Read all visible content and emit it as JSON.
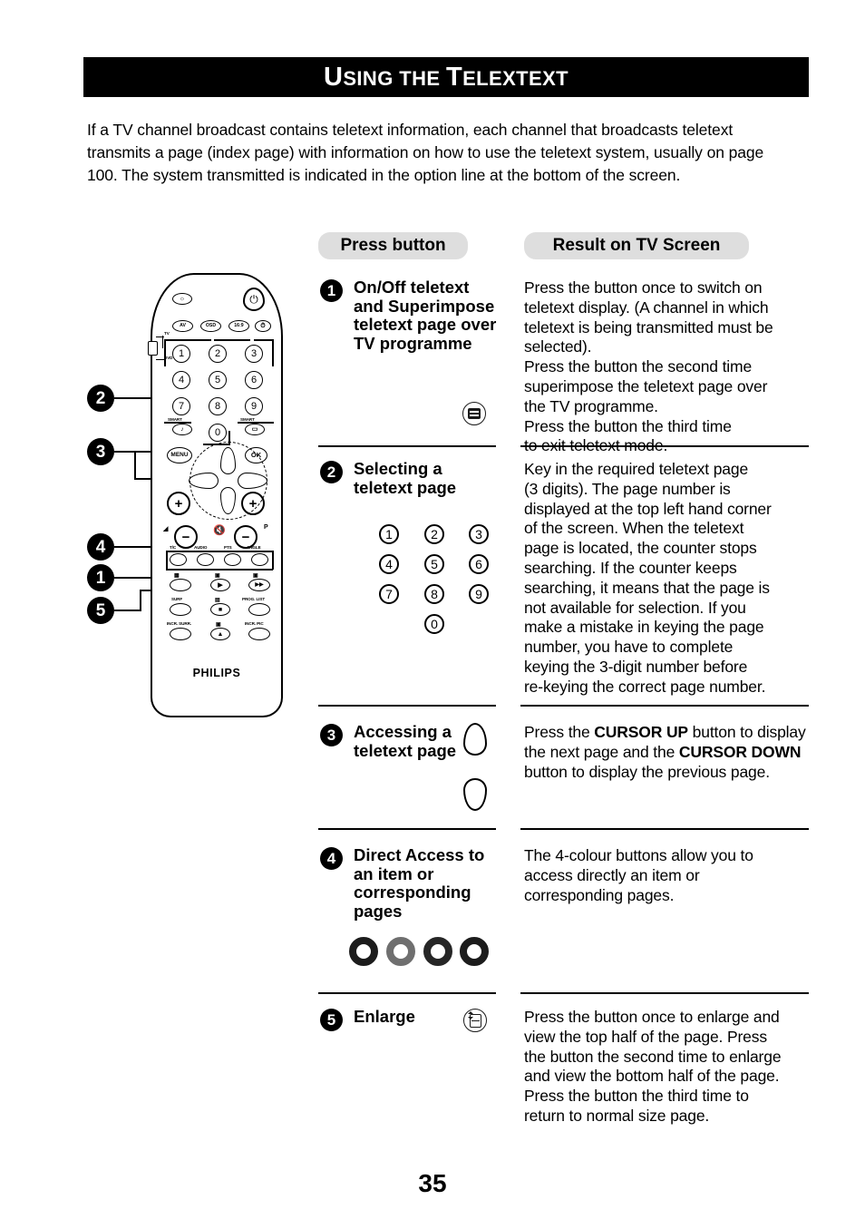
{
  "page": {
    "number": "35",
    "header_title_first_cap": "U",
    "header_title_first_rest": "SING THE ",
    "header_title_second_cap": "T",
    "header_title_second_rest": "ELEXTEXT",
    "intro": "If a TV channel broadcast contains teletext information, each channel that broadcasts teletext transmits a page (index page) with information on how to use the teletext system, usually on page 100. The system transmitted is indicated in the option line at the bottom of the screen."
  },
  "table": {
    "headers": {
      "press_button": "Press button",
      "result": "Result on TV Screen"
    },
    "rows": [
      {
        "number": "1",
        "title": "On/Off teletext and Superimpose teletext page over TV programme",
        "icon": "teletext-icon",
        "result_lines": [
          "Press the button once to switch on",
          "teletext display.  (A channel in which",
          "teletext is being transmitted must be",
          "selected).",
          "Press the button the second time",
          "superimpose the teletext page over",
          "the TV programme.",
          "Press the button the third time",
          "to exit teletext mode."
        ]
      },
      {
        "number": "2",
        "title": "Selecting a teletext page",
        "icon": "numeric-keypad-icon",
        "keypad": [
          "1",
          "2",
          "3",
          "4",
          "5",
          "6",
          "7",
          "8",
          "9",
          "0"
        ],
        "result_lines": [
          "Key in the required teletext page",
          "(3 digits). The page number is",
          "displayed at the top left hand corner",
          "of the screen.  When the teletext",
          "page is located, the counter stops",
          "searching. If the counter keeps",
          "searching, it means that the page is",
          "not available for selection. If you",
          "make a mistake in keying the page",
          "number, you have to complete",
          "keying the 3-digit number before",
          "re-keying the correct page number."
        ]
      },
      {
        "number": "3",
        "title": "Accessing a teletext page",
        "icon": "cursor-up-down-icon",
        "result_html": "Press the <b>CURSOR UP</b> button to display the next page and the <b>CURSOR DOWN</b> button to display the previous page.",
        "result_bold_terms": [
          "CURSOR UP",
          "CURSOR DOWN"
        ]
      },
      {
        "number": "4",
        "title": "Direct Access to an item or corresponding pages",
        "icon": "colour-buttons-icon",
        "colour_buttons": [
          "#1c1c1c",
          "#6f6f6f",
          "#262626",
          "#1c1c1c"
        ],
        "result_lines": [
          "The 4-colour buttons allow you to",
          "access directly an item or",
          "corresponding pages."
        ]
      },
      {
        "number": "5",
        "title": "Enlarge",
        "icon": "enlarge-icon",
        "result_lines": [
          "Press the button once to enlarge and",
          "view the top half of the page.   Press",
          "the button the second time to enlarge",
          "and view the bottom half of the page.",
          "Press the button the third time to",
          "return to  normal size page."
        ]
      }
    ]
  },
  "callouts": [
    {
      "label": "2"
    },
    {
      "label": "3"
    },
    {
      "label": "4"
    },
    {
      "label": "1"
    },
    {
      "label": "5"
    }
  ],
  "remote": {
    "brand": "PHILIPS",
    "switch_labels": {
      "top": "TV",
      "bottom": "DVD"
    },
    "top_row": {
      "left": "sound-icon",
      "power": "power-icon"
    },
    "function_row": [
      "AV",
      "OSD",
      "16:9",
      "timer-icon"
    ],
    "keypad": [
      "1",
      "2",
      "3",
      "4",
      "5",
      "6",
      "7",
      "8",
      "9",
      "0"
    ],
    "smart_labels": {
      "left": "SMART",
      "right": "SMART"
    },
    "nav": {
      "menu": "MENU",
      "ok": "OK"
    },
    "vol_prog": {
      "vol_up": "+",
      "vol_down": "−",
      "prog_up": "+",
      "prog_down": "−",
      "vol_mark": "◢",
      "prog_mark": "P",
      "mute": "mute-icon"
    },
    "colour_row_labels": [
      "T/C",
      "AUDIO",
      "PTS",
      "ANGLE"
    ],
    "media_row_labels": [
      "teletext-icon",
      "subtitle-icon",
      "zoom-icon"
    ],
    "media_row2_labels": [
      "SURF",
      "enlarge-icon",
      "PROG. LIST"
    ],
    "media_row3_labels": [
      "INCR. SURR.",
      "eject-icon",
      "INCR. PIC"
    ]
  }
}
